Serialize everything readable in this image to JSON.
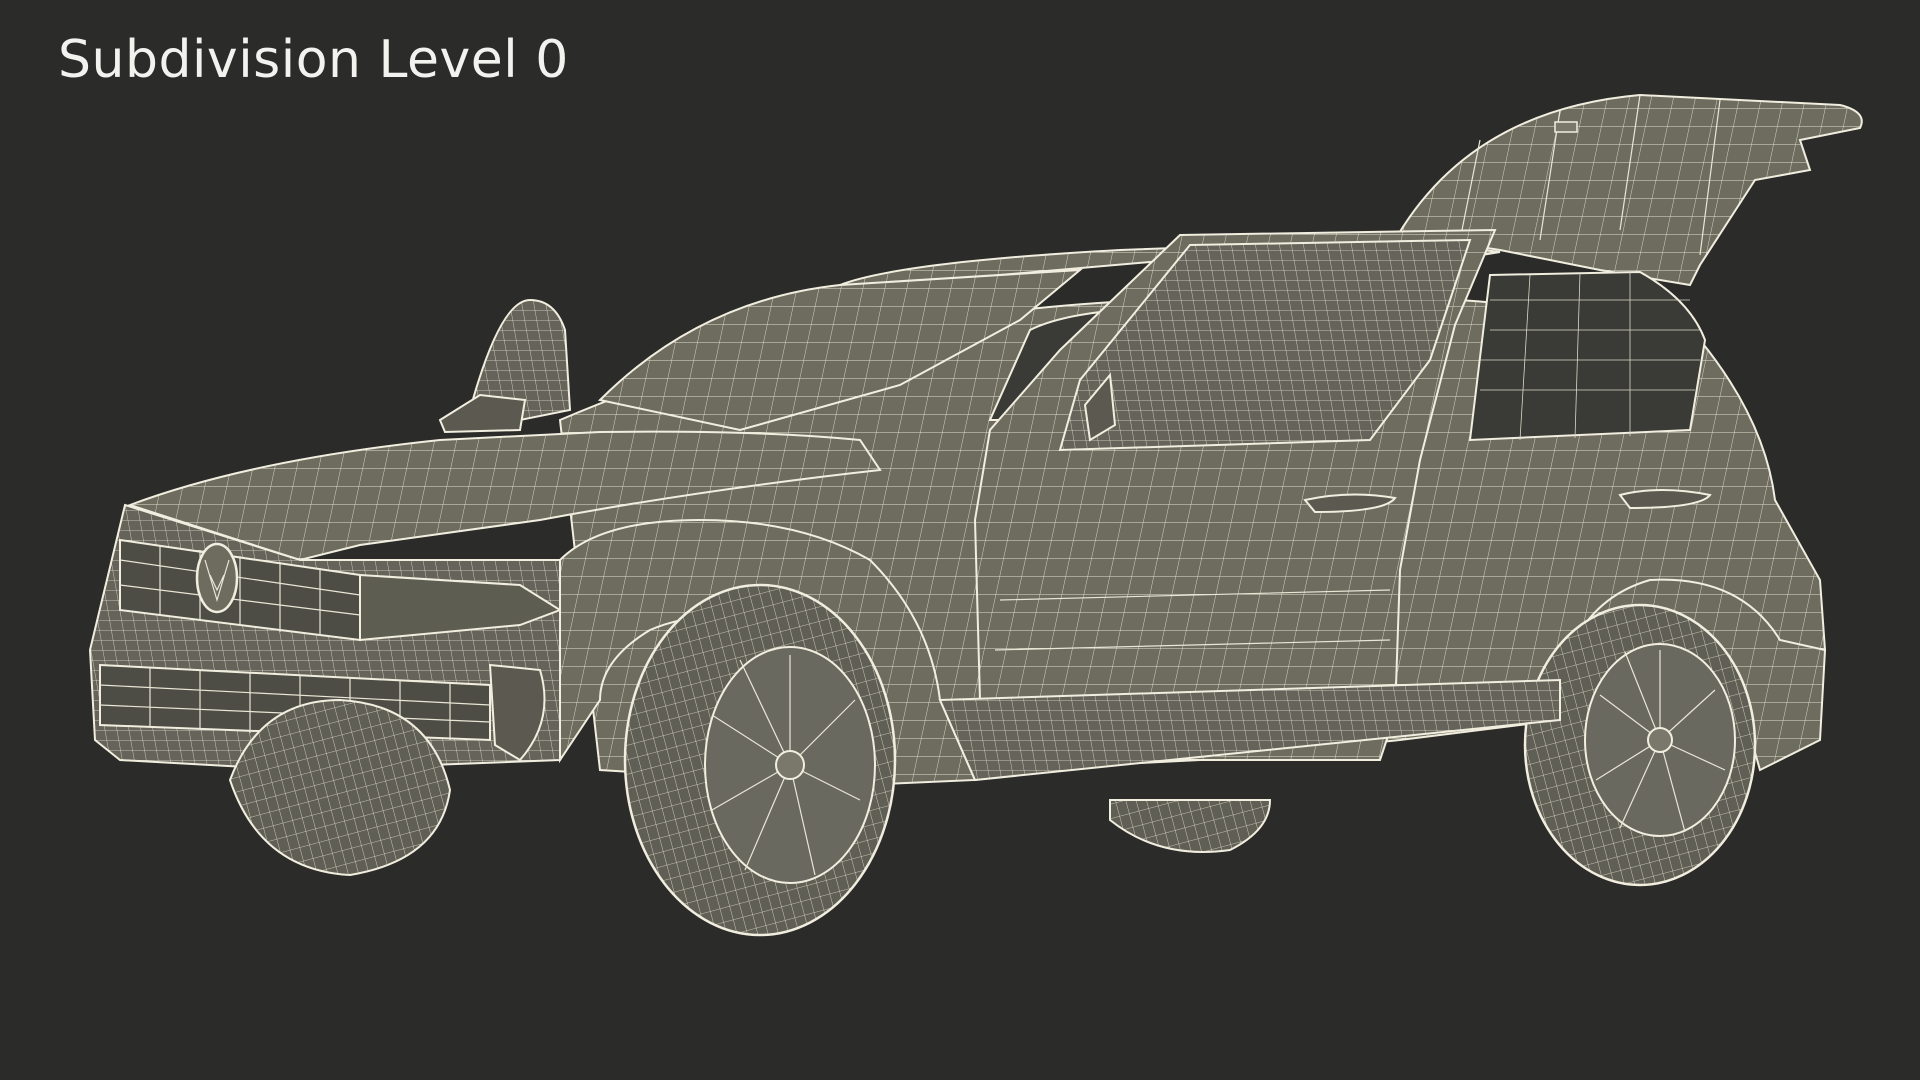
{
  "caption": "Subdivision Level 0",
  "colors": {
    "background": "#2b2b29",
    "model_fill": "#6e6c5f",
    "wireframe": "#e9e6d6"
  }
}
